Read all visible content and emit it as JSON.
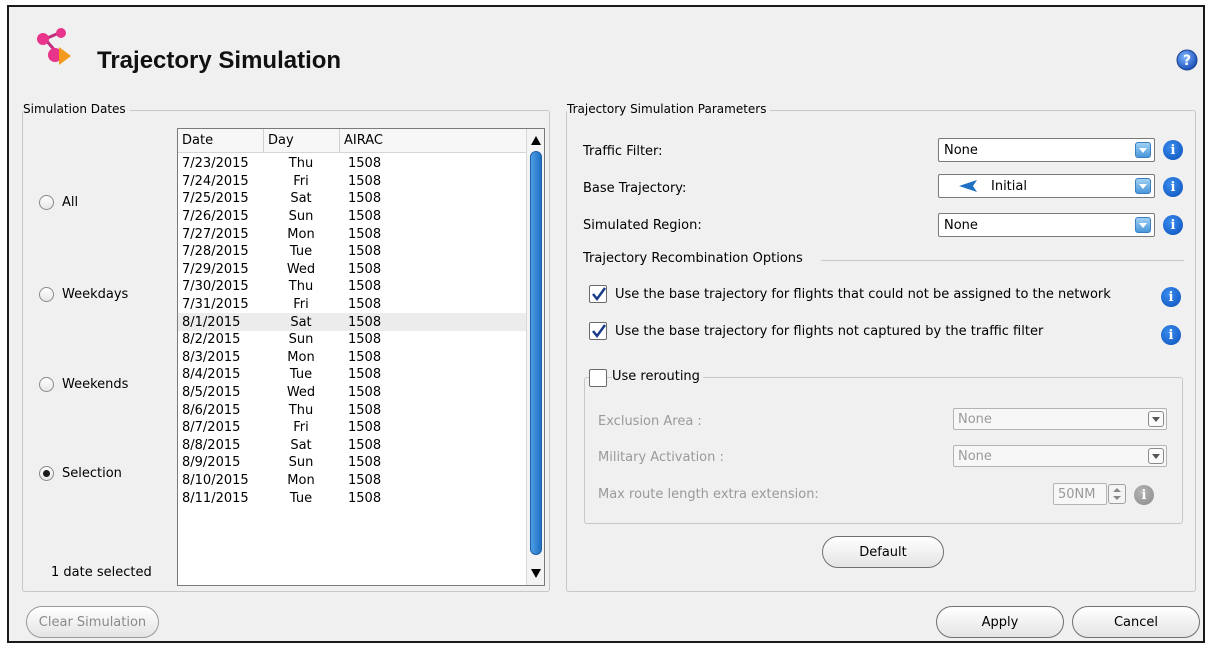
{
  "header": {
    "title": "Trajectory Simulation"
  },
  "icons": {
    "app": "network-logo-icon",
    "help": "help-icon",
    "info": "info-icon"
  },
  "colors": {
    "accent": "#1f6fc4",
    "info": "#0a4fb8",
    "logo_pink": "#e8348a",
    "logo_orange": "#f39a1c"
  },
  "dates_group": {
    "legend": "Simulation Dates",
    "options": [
      {
        "label": "All",
        "selected": false
      },
      {
        "label": "Weekdays",
        "selected": false
      },
      {
        "label": "Weekends",
        "selected": false
      },
      {
        "label": "Selection",
        "selected": true
      }
    ],
    "selected_count": "1 date selected",
    "table": {
      "columns": [
        "Date",
        "Day",
        "AIRAC"
      ],
      "rows": [
        {
          "date": "7/23/2015",
          "day": "Thu",
          "airac": "1508",
          "selected": false
        },
        {
          "date": "7/24/2015",
          "day": "Fri",
          "airac": "1508",
          "selected": false
        },
        {
          "date": "7/25/2015",
          "day": "Sat",
          "airac": "1508",
          "selected": false
        },
        {
          "date": "7/26/2015",
          "day": "Sun",
          "airac": "1508",
          "selected": false
        },
        {
          "date": "7/27/2015",
          "day": "Mon",
          "airac": "1508",
          "selected": false
        },
        {
          "date": "7/28/2015",
          "day": "Tue",
          "airac": "1508",
          "selected": false
        },
        {
          "date": "7/29/2015",
          "day": "Wed",
          "airac": "1508",
          "selected": false
        },
        {
          "date": "7/30/2015",
          "day": "Thu",
          "airac": "1508",
          "selected": false
        },
        {
          "date": "7/31/2015",
          "day": "Fri",
          "airac": "1508",
          "selected": false
        },
        {
          "date": "8/1/2015",
          "day": "Sat",
          "airac": "1508",
          "selected": true
        },
        {
          "date": "8/2/2015",
          "day": "Sun",
          "airac": "1508",
          "selected": false
        },
        {
          "date": "8/3/2015",
          "day": "Mon",
          "airac": "1508",
          "selected": false
        },
        {
          "date": "8/4/2015",
          "day": "Tue",
          "airac": "1508",
          "selected": false
        },
        {
          "date": "8/5/2015",
          "day": "Wed",
          "airac": "1508",
          "selected": false
        },
        {
          "date": "8/6/2015",
          "day": "Thu",
          "airac": "1508",
          "selected": false
        },
        {
          "date": "8/7/2015",
          "day": "Fri",
          "airac": "1508",
          "selected": false
        },
        {
          "date": "8/8/2015",
          "day": "Sat",
          "airac": "1508",
          "selected": false
        },
        {
          "date": "8/9/2015",
          "day": "Sun",
          "airac": "1508",
          "selected": false
        },
        {
          "date": "8/10/2015",
          "day": "Mon",
          "airac": "1508",
          "selected": false
        },
        {
          "date": "8/11/2015",
          "day": "Tue",
          "airac": "1508",
          "selected": false
        }
      ]
    }
  },
  "params_group": {
    "legend": "Trajectory Simulation Parameters",
    "traffic_filter": {
      "label": "Traffic Filter:",
      "value": "None"
    },
    "base_trajectory": {
      "label": "Base Trajectory:",
      "value": "Initial"
    },
    "simulated_region": {
      "label": "Simulated Region:",
      "value": "None"
    },
    "recombination_title": "Trajectory Recombination Options",
    "check_unassigned": {
      "label": "Use the base trajectory for flights that could not be assigned to the network",
      "checked": true
    },
    "check_not_captured": {
      "label": "Use the base trajectory for flights not captured by the traffic filter",
      "checked": true
    },
    "rerouting": {
      "label": "Use rerouting",
      "checked": false,
      "exclusion_area": {
        "label": "Exclusion Area :",
        "value": "None"
      },
      "military_activation": {
        "label": "Military Activation :",
        "value": "None"
      },
      "max_extension": {
        "label": "Max route length extra extension:",
        "value": "50NM"
      }
    },
    "default_button": "Default"
  },
  "footer": {
    "clear_button": "Clear Simulation",
    "apply_button": "Apply",
    "cancel_button": "Cancel"
  }
}
